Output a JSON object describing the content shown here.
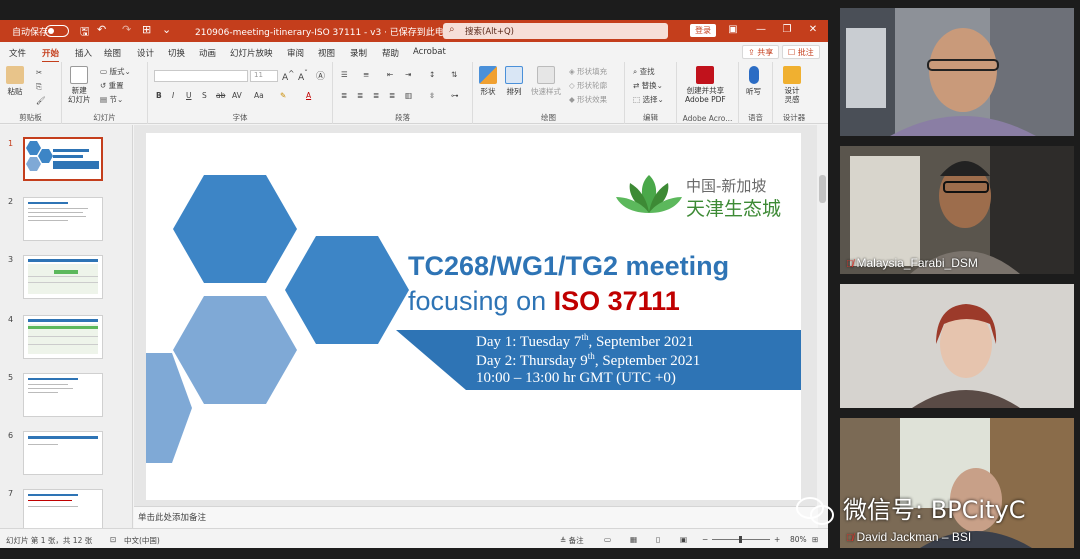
{
  "ppt": {
    "autosave_label": "自动保存",
    "autosave_state": "关",
    "doc_title": "210906-meeting-itinerary-ISO 37111 - v3 · 已保存到此电脑",
    "search_placeholder": "搜索(Alt+Q)",
    "signin_label": "登录",
    "menu": [
      "文件",
      "开始",
      "插入",
      "绘图",
      "设计",
      "切换",
      "动画",
      "幻灯片放映",
      "审阅",
      "视图",
      "录制",
      "帮助",
      "Acrobat"
    ],
    "active_tab": "开始",
    "share_label": "共享",
    "comments_label": "批注",
    "ribbon": {
      "paste": "粘贴",
      "new_slide": "新建\n幻灯片",
      "layout": "版式",
      "reset": "重置",
      "section": "节",
      "groups": [
        "剪贴板",
        "幻灯片",
        "字体",
        "段落",
        "绘图",
        "编辑",
        "Adobe Acro...",
        "语音",
        "设计器"
      ],
      "shape": "形状",
      "arrange": "排列",
      "quick_styles": "快速样式",
      "shape_fill": "形状填充",
      "shape_outline": "形状轮廓",
      "shape_effects": "形状效果",
      "find": "查找",
      "replace": "替换",
      "select": "选择",
      "create_pdf": "创建并共享\nAdobe PDF",
      "dictate": "听写",
      "designer": "设计\n灵感",
      "font_size": "11"
    },
    "thumbnails": [
      "1",
      "2",
      "3",
      "4",
      "5",
      "6",
      "7"
    ],
    "notes_placeholder": "单击此处添加备注",
    "status": {
      "slide_count": "幻灯片 第 1 张，共 12 张",
      "language": "中文(中国)",
      "notes": "备注",
      "zoom": "80%"
    }
  },
  "slide": {
    "logo_line1": "中国-新加坡",
    "logo_line2": "天津生态城",
    "title_line1": "TC268/WG1/TG2 meeting",
    "title_line2_prefix": "focusing on ",
    "title_line2_highlight": "ISO 37111",
    "day1_a": "Day 1: Tuesday 7",
    "day1_sup": "th",
    "day1_b": ", September 2021",
    "day2_a": "Day 2: Thursday 9",
    "day2_sup": "th",
    "day2_b": ", September 2021",
    "time": "10:00 – 13:00 hr GMT (UTC +0)",
    "colors": {
      "hex_dark": "#3d85c6",
      "hex_light": "#7fa9d6",
      "title": "#2e74b5",
      "highlight": "#c00000",
      "band": "#2e74b5"
    }
  },
  "participants": [
    {
      "name": ""
    },
    {
      "name": "Malaysia_Farabi_DSM"
    },
    {
      "name": ""
    },
    {
      "name": "David Jackman – BSI"
    }
  ],
  "watermark": "微信号: BPCityC"
}
